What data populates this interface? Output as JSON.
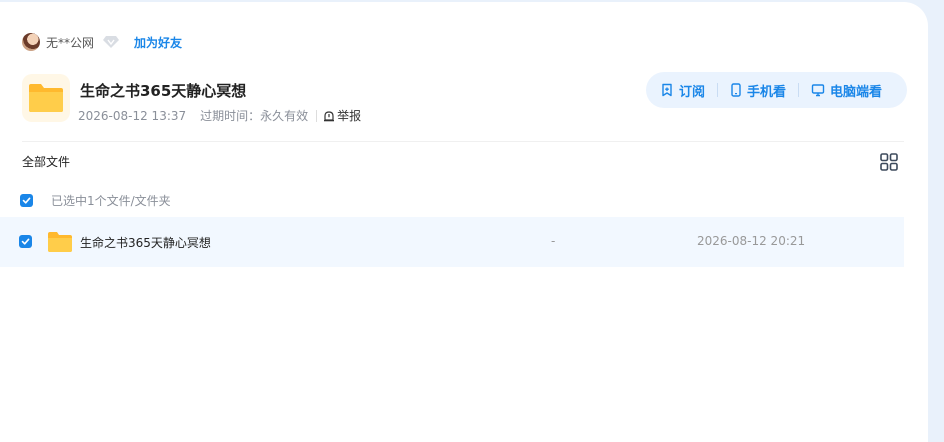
{
  "user": {
    "name": "无**公网",
    "add_friend_label": "加为好友"
  },
  "share": {
    "title": "生命之书365天静心冥想",
    "date": "2026-08-12 13:37",
    "expiry_label": "过期时间：永久有效",
    "report_label": "举报"
  },
  "actions": {
    "subscribe_label": "订阅",
    "mobile_label": "手机看",
    "pc_label": "电脑端看"
  },
  "list": {
    "header_label": "全部文件",
    "selected_text": "已选中1个文件/文件夹",
    "items": [
      {
        "name": "生命之书365天静心冥想",
        "size": "-",
        "date": "2026-08-12 20:21",
        "checked": true
      }
    ]
  },
  "colors": {
    "accent": "#1a86e8",
    "row_highlight": "#f2f8ff",
    "folder": "#ffc93a"
  }
}
